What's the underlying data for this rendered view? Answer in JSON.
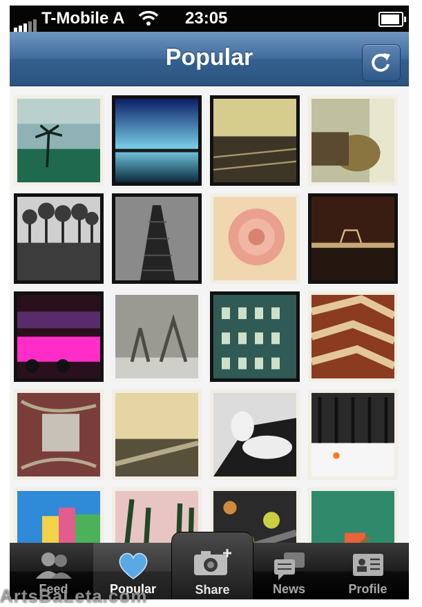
{
  "status_bar": {
    "carrier": "T-Mobile A",
    "time": "23:05"
  },
  "nav": {
    "title": "Popular",
    "refresh_icon": "refresh-icon"
  },
  "tabs": [
    {
      "label": "Feed",
      "icon": "people-icon",
      "active": false
    },
    {
      "label": "Popular",
      "icon": "heart-icon",
      "active": true
    },
    {
      "label": "Share",
      "icon": "camera-plus-icon",
      "active": false
    },
    {
      "label": "News",
      "icon": "speech-bubbles-icon",
      "active": false
    },
    {
      "label": "Profile",
      "icon": "id-card-icon",
      "active": false
    }
  ],
  "watermark": "ArtsBaLeta.com",
  "colors": {
    "nav_blue": "#3f6b9d",
    "tab_dark": "#1d1d1d",
    "heart_blue": "#5aa9e6"
  }
}
